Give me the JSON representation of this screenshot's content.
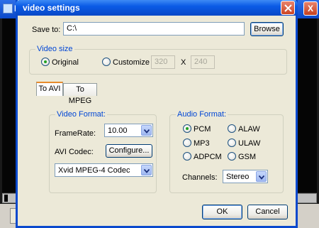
{
  "background": {
    "title": "F",
    "close_label": "X"
  },
  "dialog": {
    "title": "video settings",
    "save_to": {
      "label": "Save to:",
      "value": "C:\\",
      "browse_label": "Browse"
    },
    "video_size": {
      "group_title": "Video size",
      "original_label": "Original",
      "customize_label": "Customize",
      "width_value": "320",
      "x_label": "X",
      "height_value": "240",
      "selected": "Original"
    },
    "tabs": [
      {
        "label": "To AVI",
        "active": true
      },
      {
        "label": "To MPEG",
        "active": false
      }
    ],
    "video_format": {
      "group_title": "Video Format:",
      "framerate_label": "FrameRate:",
      "framerate_value": "10.00",
      "avi_codec_label": "AVI Codec:",
      "configure_label": "Configure...",
      "codec_value": "Xvid MPEG-4 Codec"
    },
    "audio_format": {
      "group_title": "Audio Format:",
      "options": [
        "PCM",
        "ALAW",
        "MP3",
        "ULAW",
        "ADPCM",
        "GSM"
      ],
      "selected": "PCM",
      "channels_label": "Channels:",
      "channels_value": "Stereo"
    },
    "ok_label": "OK",
    "cancel_label": "Cancel"
  }
}
